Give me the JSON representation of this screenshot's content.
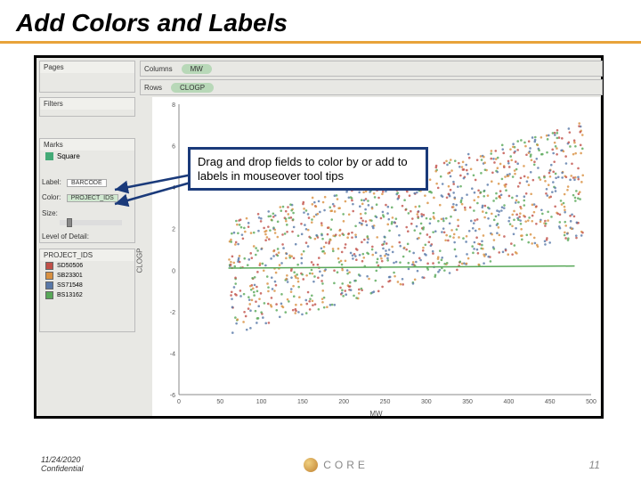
{
  "title": "Add Colors and Labels",
  "shelves": {
    "pages": "Pages",
    "filters": "Filters",
    "marks": "Marks",
    "columns": "Columns",
    "rows": "Rows",
    "label": "Label:",
    "color": "Color:",
    "size": "Size:",
    "lod": "Level of Detail:",
    "shape": "Square"
  },
  "pills": {
    "columns": "MW",
    "rows": "CLOGP",
    "label_field": "BARCODE",
    "color_field": "PROJECT_IDS"
  },
  "legend": {
    "title": "PROJECT_IDS",
    "items": [
      {
        "name": "SD50506",
        "color": "#c05048"
      },
      {
        "name": "SB23301",
        "color": "#d89040"
      },
      {
        "name": "SS71548",
        "color": "#5878a8"
      },
      {
        "name": "BS13162",
        "color": "#58a858"
      }
    ]
  },
  "callout_text": "Drag and drop fields to color by or add to labels in mouseover tool tips",
  "chart_data": {
    "type": "scatter",
    "xlabel": "MW",
    "ylabel": "CLOGP",
    "xlim": [
      0,
      500
    ],
    "ylim": [
      -6,
      8
    ],
    "xticks": [
      0,
      50,
      100,
      150,
      200,
      250,
      300,
      350,
      400,
      450,
      500
    ],
    "yticks": [
      -6,
      -4,
      -2,
      0,
      2,
      4,
      6,
      8
    ],
    "series": [
      {
        "name": "SD50506",
        "color": "#c05048"
      },
      {
        "name": "SB23301",
        "color": "#d89040"
      },
      {
        "name": "SS71548",
        "color": "#5878a8"
      },
      {
        "name": "BS13162",
        "color": "#58a858"
      }
    ],
    "note": "Dense scatter cloud ~1200 points; concentration band 100<MW<480, -2<CLOGP<6; horizontal green trend line near CLOGP≈0; positive trend overall"
  },
  "footer": {
    "date": "11/24/2020",
    "conf": "Confidential",
    "logo": "CORE",
    "page": "11"
  }
}
